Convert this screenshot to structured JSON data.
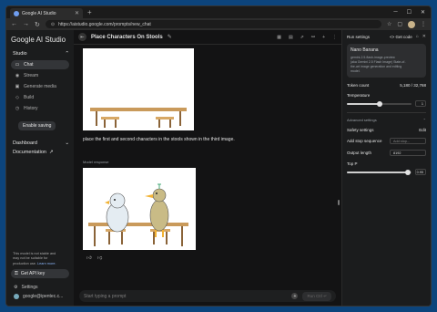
{
  "browser": {
    "tab_title": "Google AI Studio",
    "url": "https://aistudio.google.com/prompts/new_chat"
  },
  "sidebar": {
    "brand": "Google AI Studio",
    "studio_label": "Studio",
    "items": [
      {
        "label": "Chat",
        "icon": "chat-icon"
      },
      {
        "label": "Stream",
        "icon": "stream-icon"
      },
      {
        "label": "Generate media",
        "icon": "media-icon"
      },
      {
        "label": "Build",
        "icon": "build-icon"
      },
      {
        "label": "History",
        "icon": "history-icon"
      }
    ],
    "enable_saving": "Enable saving",
    "dashboard": "Dashboard",
    "documentation": "Documentation",
    "note_lines": [
      "This model is not stable and",
      "may not be suitable for",
      "production use."
    ],
    "note_link": "Learn more.",
    "get_api_key": "Get API key",
    "settings": "Settings",
    "account": "google@ipentec.c..."
  },
  "main": {
    "title": "Place Characters On Stools",
    "prompt_text": "place the first and second characters in the stools shown in the third image.",
    "response_label": "Model response",
    "input_placeholder": "Start typing a prompt",
    "run_label": "Run  Ctrl ↵"
  },
  "run_settings": {
    "title": "Run settings",
    "get_code": "Get code",
    "model_name": "Nano Banana",
    "model_desc_lines": [
      "gemini-2.5-flash-image-preview",
      "(aka Gemini 2.5 Flash Image) State-of-",
      "the-art image generation and editing",
      "model."
    ],
    "token_count_label": "Token count",
    "token_count_value": "5,180 / 32,768",
    "temperature_label": "Temperature",
    "temperature_value": "1",
    "temperature_fraction": 0.5,
    "advanced_label": "Advanced settings",
    "safety_label": "Safety settings",
    "safety_edit": "Edit",
    "stop_label": "Add stop sequence",
    "stop_placeholder": "Add stop...",
    "output_length_label": "Output length",
    "output_length_value": "8192",
    "top_p_label": "Top P",
    "top_p_value": "0.95",
    "top_p_fraction": 0.95
  },
  "colors": {
    "desktop": "#0c447c",
    "panel": "#1b1c1d",
    "main_bg": "#131314",
    "accent_link": "#8ab4f8"
  }
}
